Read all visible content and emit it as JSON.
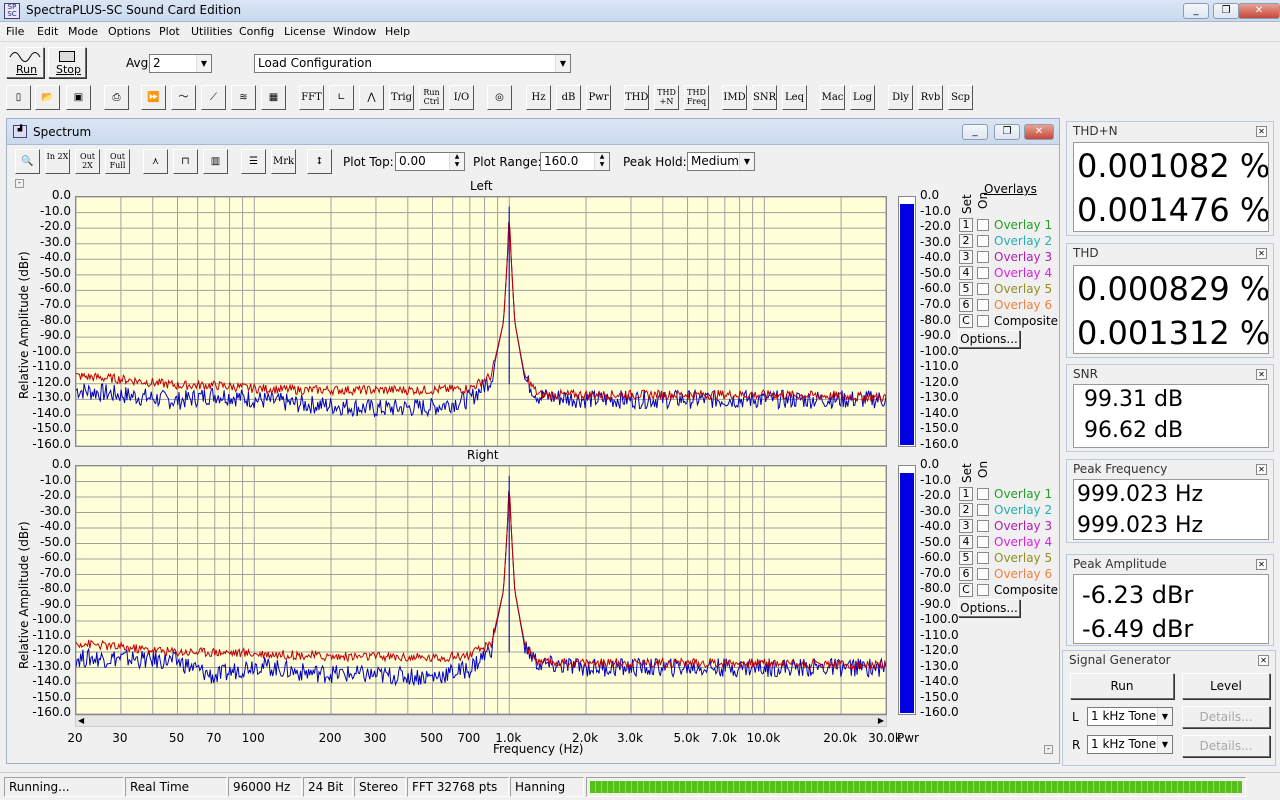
{
  "window": {
    "title": "SpectraPLUS-SC Sound Card Edition",
    "app_icon_text": "SP SC"
  },
  "menu": [
    "File",
    "Edit",
    "Mode",
    "Options",
    "Plot",
    "Utilities",
    "Config",
    "License",
    "Window",
    "Help"
  ],
  "controls": {
    "run_label": "Run",
    "stop_label": "Stop",
    "avg_label": "Avg",
    "avg_value": "2",
    "config_value": "Load Configuration"
  },
  "toolbar": [
    {
      "name": "new-file",
      "label": "",
      "icon": "new-file-icon"
    },
    {
      "name": "open",
      "label": "",
      "icon": "open-folder-icon"
    },
    {
      "name": "save",
      "label": "",
      "icon": "save-disk-icon"
    },
    {
      "name": "print",
      "label": "",
      "icon": "printer-icon"
    },
    {
      "name": "fast-forward",
      "label": "",
      "icon": "fast-forward-icon"
    },
    {
      "name": "wave-edit",
      "label": "",
      "icon": "wave-edit-icon"
    },
    {
      "name": "ramp",
      "label": "",
      "icon": "ramp-icon"
    },
    {
      "name": "waterfall",
      "label": "",
      "icon": "waterfall-icon"
    },
    {
      "name": "3d-surface",
      "label": "",
      "icon": "surface-3d-icon"
    },
    {
      "name": "fft",
      "label": "FFT",
      "icon": ""
    },
    {
      "name": "phase",
      "label": "",
      "icon": "phase-plot-icon"
    },
    {
      "name": "spectrum-peak",
      "label": "",
      "icon": "peak-icon"
    },
    {
      "name": "trig",
      "label": "Trig",
      "icon": ""
    },
    {
      "name": "run-ctrl",
      "label": "Run Ctrl",
      "icon": ""
    },
    {
      "name": "io",
      "label": "I/O",
      "icon": ""
    },
    {
      "name": "generator",
      "label": "",
      "icon": "sine-circle-icon"
    },
    {
      "name": "hz",
      "label": "Hz",
      "icon": ""
    },
    {
      "name": "db",
      "label": "dB",
      "icon": ""
    },
    {
      "name": "pwr",
      "label": "Pwr",
      "icon": ""
    },
    {
      "name": "thd",
      "label": "THD",
      "icon": ""
    },
    {
      "name": "thd-n",
      "label": "THD +N",
      "icon": ""
    },
    {
      "name": "thd-freq",
      "label": "THD Freq",
      "icon": ""
    },
    {
      "name": "imd",
      "label": "IMD",
      "icon": ""
    },
    {
      "name": "snr",
      "label": "SNR",
      "icon": ""
    },
    {
      "name": "leq",
      "label": "Leq",
      "icon": ""
    },
    {
      "name": "mac",
      "label": "Mac",
      "icon": ""
    },
    {
      "name": "log",
      "label": "Log",
      "icon": ""
    },
    {
      "name": "dly",
      "label": "Dly",
      "icon": ""
    },
    {
      "name": "rvb",
      "label": "Rvb",
      "icon": ""
    },
    {
      "name": "scp",
      "label": "Scp",
      "icon": ""
    }
  ],
  "spectrum": {
    "title": "Spectrum",
    "tools": [
      {
        "label": "",
        "icon": "zoom-magnifier-icon"
      },
      {
        "label": "In 2X",
        "icon": ""
      },
      {
        "label": "Out 2X",
        "icon": ""
      },
      {
        "label": "Out Full",
        "icon": ""
      },
      {
        "label": "",
        "icon": "line-plot-icon"
      },
      {
        "label": "",
        "icon": "step-plot-icon"
      },
      {
        "label": "",
        "icon": "bar-plot-icon"
      },
      {
        "label": "",
        "icon": "list-view-icon"
      },
      {
        "label": "Mrk",
        "icon": ""
      },
      {
        "label": "",
        "icon": "vertical-range-icon"
      }
    ],
    "plot_top_label": "Plot Top:",
    "plot_top_value": "0.00",
    "plot_range_label": "Plot Range:",
    "plot_range_value": "160.0",
    "peak_hold_label": "Peak Hold:",
    "peak_hold_value": "Medium",
    "overlays_label": "Overlays",
    "set_label": "Set",
    "on_label": "On",
    "options_label": "Options...",
    "overlays": [
      {
        "num": "1",
        "label": "Overlay 1",
        "color": "#22a022"
      },
      {
        "num": "2",
        "label": "Overlay 2",
        "color": "#20b0b0"
      },
      {
        "num": "3",
        "label": "Overlay 3",
        "color": "#b020b0"
      },
      {
        "num": "4",
        "label": "Overlay 4",
        "color": "#e020e0"
      },
      {
        "num": "5",
        "label": "Overlay 5",
        "color": "#909020"
      },
      {
        "num": "6",
        "label": "Overlay 6",
        "color": "#f08040"
      },
      {
        "num": "C",
        "label": "Composite",
        "color": "#000000"
      }
    ],
    "x_axis_label": "Frequency (Hz)",
    "pwr_label": "Pwr"
  },
  "chart_data": [
    {
      "type": "line",
      "title": "Left",
      "xlabel": "Frequency (Hz)",
      "ylabel": "Relative Amplitude (dBr)",
      "x_scale": "log",
      "xlim": [
        20,
        30000
      ],
      "ylim": [
        -160,
        0
      ],
      "y_ticks": [
        "0.0",
        "-10.0",
        "-20.0",
        "-30.0",
        "-40.0",
        "-50.0",
        "-60.0",
        "-70.0",
        "-80.0",
        "-90.0",
        "-100.0",
        "-110.0",
        "-120.0",
        "-130.0",
        "-140.0",
        "-150.0",
        "-160.0"
      ],
      "x_ticks": [
        "20",
        "30",
        "50",
        "70",
        "100",
        "200",
        "300",
        "500",
        "700",
        "1.0k",
        "2.0k",
        "3.0k",
        "5.0k",
        "7.0k",
        "10.0k",
        "20.0k",
        "30.0k"
      ],
      "grid": true,
      "series": [
        {
          "color": "#0000c0",
          "points": [
            [
              20,
              -124
            ],
            [
              30,
              -127
            ],
            [
              50,
              -131
            ],
            [
              70,
              -127
            ],
            [
              100,
              -130
            ],
            [
              150,
              -133
            ],
            [
              200,
              -134
            ],
            [
              300,
              -136
            ],
            [
              500,
              -135
            ],
            [
              700,
              -130
            ],
            [
              850,
              -117
            ],
            [
              950,
              -80
            ],
            [
              990,
              -30
            ],
            [
              999,
              -6.2
            ],
            [
              1010,
              -30
            ],
            [
              1050,
              -80
            ],
            [
              1150,
              -117
            ],
            [
              1300,
              -128
            ],
            [
              2000,
              -130
            ],
            [
              3000,
              -130
            ],
            [
              5000,
              -130
            ],
            [
              10000,
              -130
            ],
            [
              20000,
              -130
            ],
            [
              30000,
              -130
            ]
          ]
        },
        {
          "color": "#c00000",
          "points": [
            [
              20,
              -115
            ],
            [
              30,
              -117
            ],
            [
              50,
              -121
            ],
            [
              70,
              -121
            ],
            [
              100,
              -123
            ],
            [
              150,
              -124
            ],
            [
              200,
              -124
            ],
            [
              300,
              -124
            ],
            [
              500,
              -124
            ],
            [
              700,
              -123
            ],
            [
              850,
              -115
            ],
            [
              950,
              -80
            ],
            [
              990,
              -30
            ],
            [
              999,
              -6.2
            ],
            [
              1010,
              -30
            ],
            [
              1050,
              -80
            ],
            [
              1150,
              -115
            ],
            [
              1300,
              -127
            ],
            [
              2000,
              -127
            ],
            [
              3000,
              -127
            ],
            [
              5000,
              -127
            ],
            [
              10000,
              -127
            ],
            [
              20000,
              -128
            ],
            [
              30000,
              -129
            ]
          ]
        }
      ],
      "meter_level_dbr": -155.0
    },
    {
      "type": "line",
      "title": "Right",
      "xlabel": "Frequency (Hz)",
      "ylabel": "Relative Amplitude (dBr)",
      "x_scale": "log",
      "xlim": [
        20,
        30000
      ],
      "ylim": [
        -160,
        0
      ],
      "y_ticks": [
        "0.0",
        "-10.0",
        "-20.0",
        "-30.0",
        "-40.0",
        "-50.0",
        "-60.0",
        "-70.0",
        "-80.0",
        "-90.0",
        "-100.0",
        "-110.0",
        "-120.0",
        "-130.0",
        "-140.0",
        "-150.0",
        "-160.0"
      ],
      "x_ticks": [
        "20",
        "30",
        "50",
        "70",
        "100",
        "200",
        "300",
        "500",
        "700",
        "1.0k",
        "2.0k",
        "3.0k",
        "5.0k",
        "7.0k",
        "10.0k",
        "20.0k",
        "30.0k"
      ],
      "grid": true,
      "series": [
        {
          "color": "#0000c0",
          "points": [
            [
              20,
              -124
            ],
            [
              30,
              -124
            ],
            [
              50,
              -126
            ],
            [
              70,
              -136
            ],
            [
              100,
              -128
            ],
            [
              150,
              -133
            ],
            [
              200,
              -134
            ],
            [
              300,
              -135
            ],
            [
              500,
              -136
            ],
            [
              700,
              -131
            ],
            [
              850,
              -118
            ],
            [
              950,
              -80
            ],
            [
              990,
              -30
            ],
            [
              999,
              -6.5
            ],
            [
              1010,
              -30
            ],
            [
              1050,
              -80
            ],
            [
              1150,
              -117
            ],
            [
              1300,
              -128
            ],
            [
              2000,
              -130
            ],
            [
              3000,
              -130
            ],
            [
              5000,
              -130
            ],
            [
              10000,
              -130
            ],
            [
              20000,
              -130
            ],
            [
              30000,
              -130
            ]
          ]
        },
        {
          "color": "#c00000",
          "points": [
            [
              20,
              -114
            ],
            [
              30,
              -117
            ],
            [
              50,
              -120
            ],
            [
              70,
              -120
            ],
            [
              100,
              -121
            ],
            [
              150,
              -122
            ],
            [
              200,
              -123
            ],
            [
              300,
              -123
            ],
            [
              500,
              -124
            ],
            [
              700,
              -122
            ],
            [
              850,
              -115
            ],
            [
              950,
              -80
            ],
            [
              990,
              -30
            ],
            [
              999,
              -6.5
            ],
            [
              1010,
              -30
            ],
            [
              1050,
              -80
            ],
            [
              1150,
              -115
            ],
            [
              1300,
              -127
            ],
            [
              2000,
              -127
            ],
            [
              3000,
              -127
            ],
            [
              5000,
              -127
            ],
            [
              10000,
              -127
            ],
            [
              20000,
              -128
            ],
            [
              30000,
              -129
            ]
          ]
        }
      ],
      "meter_level_dbr": -155.0
    }
  ],
  "panels": {
    "thdn": {
      "title": "THD+N",
      "val1": "0.001082 %",
      "val2": "0.001476 %"
    },
    "thd": {
      "title": "THD",
      "val1": "0.000829 %",
      "val2": "0.001312 %"
    },
    "snr": {
      "title": "SNR",
      "val1": "99.31 dB",
      "val2": "96.62 dB"
    },
    "peakfreq": {
      "title": "Peak Frequency",
      "val1": "999.023 Hz",
      "val2": "999.023 Hz"
    },
    "peakamp": {
      "title": "Peak Amplitude",
      "val1": "-6.23 dBr",
      "val2": "-6.49 dBr"
    }
  },
  "generator": {
    "title": "Signal Generator",
    "run_label": "Run",
    "level_label": "Level",
    "l_label": "L",
    "r_label": "R",
    "l_value": "1 kHz Tone",
    "r_value": "1 kHz Tone",
    "details_label": "Details..."
  },
  "status": {
    "state": "Running...",
    "mode": "Real Time",
    "rate": "96000 Hz",
    "bits": "24 Bit",
    "channels": "Stereo",
    "fft": "FFT 32768 pts",
    "window": "Hanning",
    "progress": 1.0
  }
}
